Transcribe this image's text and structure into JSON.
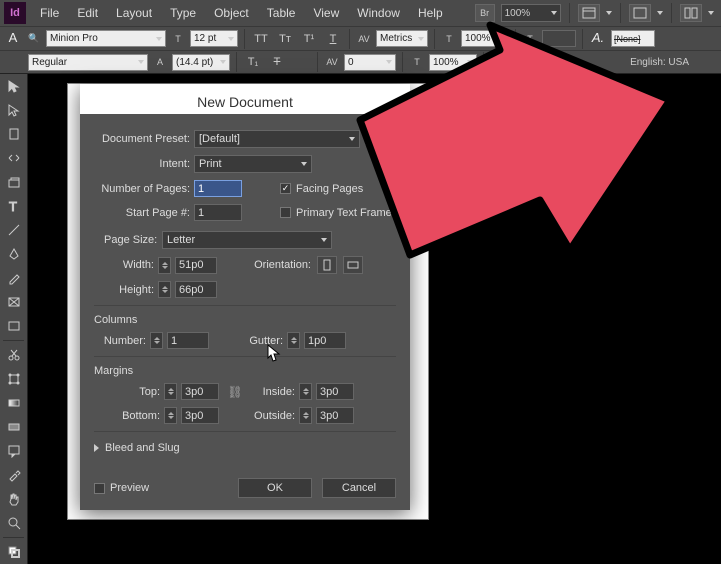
{
  "menubar": {
    "app": "Id",
    "items": [
      "File",
      "Edit",
      "Layout",
      "Type",
      "Object",
      "Table",
      "View",
      "Window",
      "Help"
    ],
    "br": "Br",
    "zoom": "100%"
  },
  "ctrlbar": {
    "font": "Minion Pro",
    "style": "Regular",
    "size": "12 pt",
    "leading": "(14.4 pt)",
    "kerning": "Metrics",
    "tracking": "0",
    "vscale": "100%",
    "hscale": "100%",
    "none": "[None]",
    "lang": "English: USA"
  },
  "dialog": {
    "title": "New Document",
    "preset_label": "Document Preset:",
    "preset_value": "[Default]",
    "intent_label": "Intent:",
    "intent_value": "Print",
    "numpages_label": "Number of Pages:",
    "numpages_value": "1",
    "facing_label": "Facing Pages",
    "startpage_label": "Start Page #:",
    "startpage_value": "1",
    "primarytext_label": "Primary Text Frame",
    "pagesize_label": "Page Size:",
    "pagesize_value": "Letter",
    "width_label": "Width:",
    "width_value": "51p0",
    "height_label": "Height:",
    "height_value": "66p0",
    "orientation_label": "Orientation:",
    "columns_header": "Columns",
    "colnum_label": "Number:",
    "colnum_value": "1",
    "gutter_label": "Gutter:",
    "gutter_value": "1p0",
    "margins_header": "Margins",
    "top_label": "Top:",
    "top_value": "3p0",
    "bottom_label": "Bottom:",
    "bottom_value": "3p0",
    "inside_label": "Inside:",
    "inside_value": "3p0",
    "outside_label": "Outside:",
    "outside_value": "3p0",
    "bleed_label": "Bleed and Slug",
    "preview_label": "Preview",
    "ok": "OK",
    "cancel": "Cancel"
  }
}
